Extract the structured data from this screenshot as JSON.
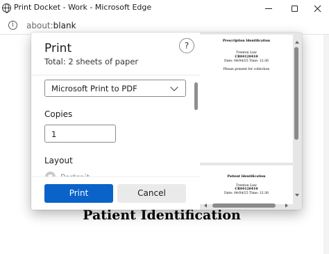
{
  "window": {
    "title": "Print Docket - Work - Microsoft Edge"
  },
  "address": {
    "scheme": "about:",
    "rest": "blank"
  },
  "page": {
    "heading": "Patient Identification"
  },
  "print": {
    "title": "Print",
    "total": "Total: 2 sheets of paper",
    "help_label": "?",
    "printer": "Microsoft Print to PDF",
    "copies_label": "Copies",
    "copies_value": "1",
    "layout_label": "Layout",
    "layout_option": "Portrait",
    "print_button": "Print",
    "cancel_button": "Cancel"
  },
  "preview": {
    "sheet1": {
      "heading": "Prescription Identification",
      "name": "Trenton Law",
      "id": "CR04120410",
      "datetime": "Date: 04/04/25 Time: 12:36",
      "note": "Please present for collection"
    },
    "sheet2": {
      "heading": "Patient Identification",
      "name": "Trenton Law",
      "id": "CR04120410",
      "datetime": "Date: 04/04/25 Time: 12:36"
    }
  },
  "colors": {
    "primary_button": "#0a63c9",
    "secondary_button": "#eaeaea",
    "preview_background": "#e6e6e6"
  },
  "icons": {
    "site": "globe-icon",
    "info": "info-icon",
    "help": "help-icon",
    "dropdown": "chevron-down-icon"
  }
}
